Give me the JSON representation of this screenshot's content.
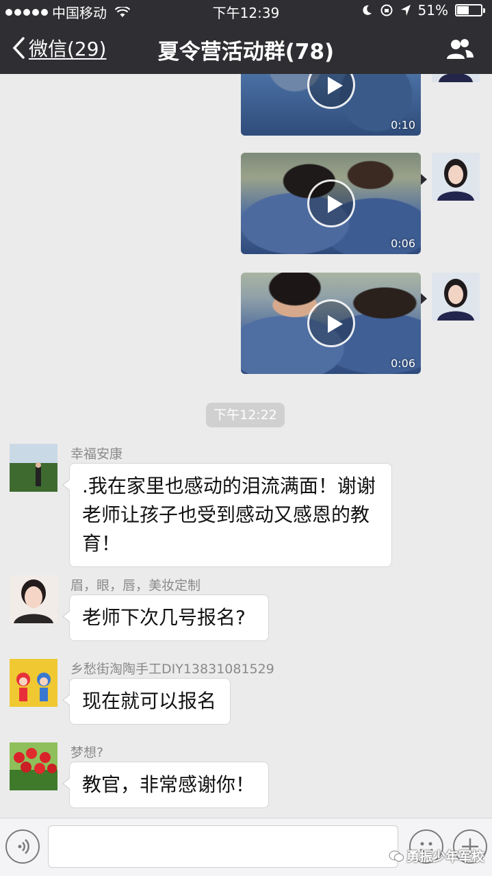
{
  "status_bar": {
    "carrier": "中国移动",
    "time": "下午12:39",
    "battery_text": "51%",
    "battery_level": 0.51
  },
  "nav": {
    "back_label": "微信(29)",
    "title": "夏令营活动群(78)",
    "group_icon": "group-members-icon"
  },
  "videos": [
    {
      "duration": "0:10"
    },
    {
      "duration": "0:06"
    },
    {
      "duration": "0:06"
    }
  ],
  "timestamp": "下午12:22",
  "messages": [
    {
      "sender": "幸福安康",
      "lines": [
        ".我在家里也感动的泪流满面！谢谢",
        "老师让孩子也受到感动又感恩的教",
        "育！"
      ]
    },
    {
      "sender": "眉，眼，唇，美妆定制",
      "text": "老师下次几号报名?"
    },
    {
      "sender": "乡愁街淘陶手工DIY13831081529",
      "text": "现在就可以报名"
    },
    {
      "sender": "梦想?",
      "text": "教官，非常感谢你！"
    }
  ],
  "input_bar": {
    "voice_icon": "voice-icon",
    "emoji_icon": "emoji-icon",
    "plus_icon": "plus-icon",
    "watermark": "勇振少年军校"
  },
  "colors": {
    "nav_bg": "#2f2f33",
    "chat_bg": "#ebebeb"
  }
}
